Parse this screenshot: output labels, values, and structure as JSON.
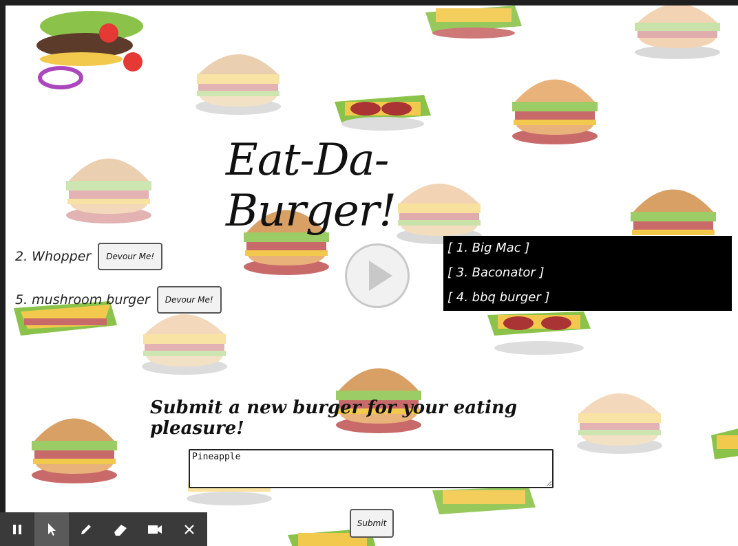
{
  "title": "Eat-Da-Burger!",
  "subtitle": "Submit a new burger for your eating pleasure!",
  "uneaten": [
    {
      "name": "2. Whopper",
      "button": "Devour Me!"
    },
    {
      "name": "5. mushroom burger",
      "button": "Devour Me!"
    }
  ],
  "eaten": [
    "[ 1. Big Mac ]",
    "[ 3. Baconator ]",
    "[ 4. bbq burger ]"
  ],
  "form": {
    "input_value": "Pineapple ",
    "submit_label": "Submit"
  },
  "toolbar": {
    "icons": [
      "pause-icon",
      "pointer-icon",
      "pen-icon",
      "eraser-icon",
      "camera-icon",
      "close-icon"
    ]
  },
  "colors": {
    "bun": "#e9b27a",
    "patty": "#c96a6a",
    "lettuce": "#9ccc65",
    "cheese": "#f2c94c",
    "eaten_bg": "#000000"
  }
}
